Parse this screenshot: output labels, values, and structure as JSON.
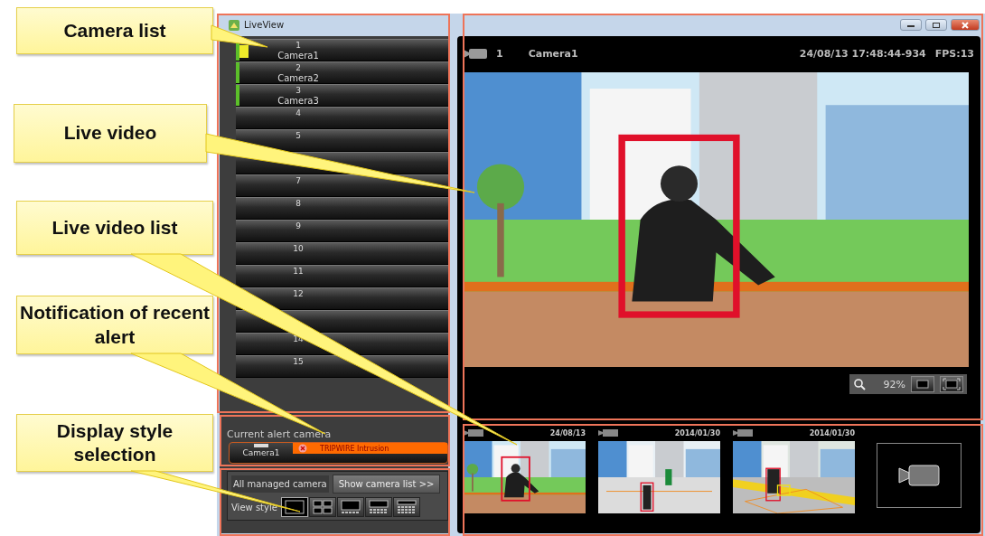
{
  "callouts": [
    {
      "label": "Camera list"
    },
    {
      "label": "Live video"
    },
    {
      "label": "Live video list"
    },
    {
      "label": "Notification of recent alert"
    },
    {
      "label": "Display style selection"
    }
  ],
  "window": {
    "title": "LiveView"
  },
  "camera_list": {
    "items": [
      {
        "kind": "camera",
        "number": "1",
        "name": "Camera1",
        "alert": true
      },
      {
        "kind": "camera",
        "number": "2",
        "name": "Camera2",
        "alert": false
      },
      {
        "kind": "camera",
        "number": "3",
        "name": "Camera3",
        "alert": false
      },
      {
        "kind": "slot",
        "number": "4"
      },
      {
        "kind": "slot",
        "number": "5"
      },
      {
        "kind": "blank"
      },
      {
        "kind": "slot",
        "number": "7"
      },
      {
        "kind": "slot",
        "number": "8"
      },
      {
        "kind": "slot",
        "number": "9"
      },
      {
        "kind": "slot",
        "number": "10"
      },
      {
        "kind": "slot",
        "number": "11"
      },
      {
        "kind": "slot",
        "number": "12"
      },
      {
        "kind": "blank"
      },
      {
        "kind": "slot",
        "number": "14"
      },
      {
        "kind": "slot",
        "number": "15"
      }
    ]
  },
  "alert": {
    "title": "Current alert camera",
    "camera": "Camera1",
    "message": "TRIPWIRE Intrusion"
  },
  "view": {
    "tab": {
      "label": "All managed camera",
      "selected": true
    },
    "button": "Show camera list >>",
    "label": "View style",
    "styles": [
      {
        "kind": "single",
        "selected": true
      },
      {
        "kind": "quad",
        "selected": false
      },
      {
        "kind": "main-strip",
        "selected": false
      },
      {
        "kind": "main-grid",
        "selected": false
      },
      {
        "kind": "grid",
        "selected": false
      }
    ]
  },
  "video": {
    "number": "1",
    "camera": "Camera1",
    "timestamp": "24/08/13 17:48:44-934",
    "fps": "FPS:13",
    "zoom": "92%"
  },
  "thumbnails": [
    {
      "kind": "picture",
      "date": "24/08/13"
    },
    {
      "kind": "picture",
      "date": "2014/01/30"
    },
    {
      "kind": "picture",
      "date": "2014/01/30"
    },
    {
      "kind": "empty"
    }
  ]
}
